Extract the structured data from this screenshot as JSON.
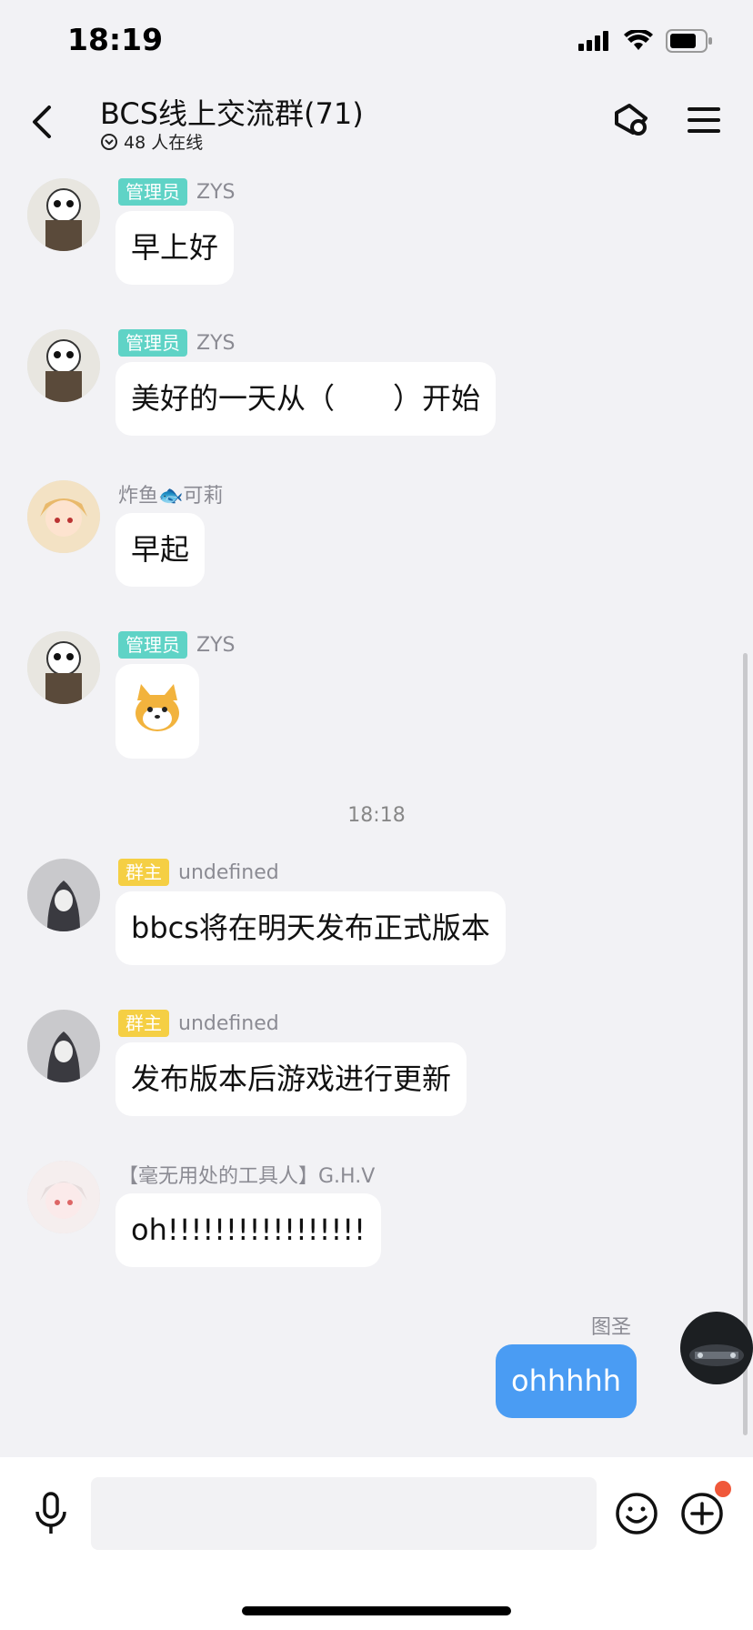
{
  "status_bar": {
    "time": "18:19"
  },
  "header": {
    "title": "BCS线上交流群(71)",
    "online": "48 人在线"
  },
  "messages": [
    {
      "tag": "管理员",
      "name": "ZYS",
      "text": "早上好"
    },
    {
      "tag": "管理员",
      "name": "ZYS",
      "text": "美好的一天从（　　）开始"
    },
    {
      "tag": "",
      "name": "炸鱼🐟可莉",
      "text": "早起"
    },
    {
      "tag": "管理员",
      "name": "ZYS",
      "sticker": "shiba-sticker"
    },
    {
      "tag": "群主",
      "name": "undefined",
      "text": "bbcs将在明天发布正式版本"
    },
    {
      "tag": "群主",
      "name": "undefined",
      "text": "发布版本后游戏进行更新"
    },
    {
      "tag": "",
      "name": "【毫无用处的工具人】G.H.V",
      "text": "oh!!!!!!!!!!!!!!!!!"
    }
  ],
  "time_separator": "18:18",
  "my_message": {
    "name": "图圣",
    "text": "ohhhhh"
  },
  "input": {
    "placeholder": ""
  },
  "colors": {
    "admin_tag": "#5fd3c6",
    "owner_tag": "#f5cf44",
    "my_bubble": "#4a9cf3",
    "notification_dot": "#f0583a"
  }
}
